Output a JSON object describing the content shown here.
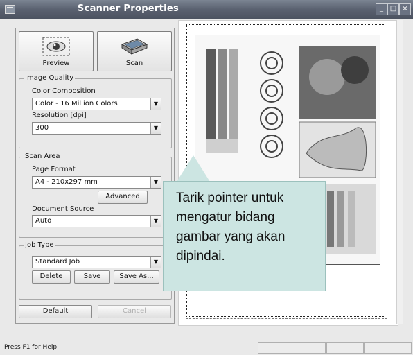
{
  "window": {
    "title": "Scanner Properties",
    "controls": [
      "_",
      "□",
      "×"
    ]
  },
  "preview_button": {
    "label": "Preview",
    "icon": "eye-icon"
  },
  "scan_button": {
    "label": "Scan",
    "icon": "scanner-icon"
  },
  "image_quality": {
    "title": "Image Quality",
    "color_label": "Color Composition",
    "color_value": "Color - 16 Million Colors",
    "resolution_label": "Resolution [dpi]",
    "resolution_value": "300"
  },
  "scan_area": {
    "title": "Scan Area",
    "page_format_label": "Page Format",
    "page_format_value": "A4 - 210x297 mm",
    "advanced_label": "Advanced",
    "source_label": "Document Source",
    "source_value": "Auto"
  },
  "job_type": {
    "title": "Job Type",
    "value": "Standard Job",
    "delete_label": "Delete",
    "save_label": "Save",
    "save_as_label": "Save As..."
  },
  "default_label": "Default",
  "cancel_label": "Cancel",
  "callout": {
    "text": "Tarik pointer untuk mengatur bidang gambar yang akan dipindai."
  },
  "status": {
    "text": "Press F1 for Help"
  }
}
